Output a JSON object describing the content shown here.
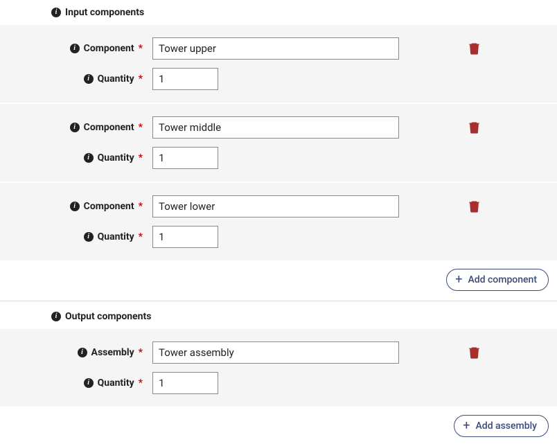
{
  "input_section": {
    "title": "Input components",
    "component_label": "Component",
    "quantity_label": "Quantity",
    "add_button_label": "Add component",
    "rows": [
      {
        "component": "Tower upper",
        "quantity": "1"
      },
      {
        "component": "Tower middle",
        "quantity": "1"
      },
      {
        "component": "Tower lower",
        "quantity": "1"
      }
    ]
  },
  "output_section": {
    "title": "Output components",
    "assembly_label": "Assembly",
    "quantity_label": "Quantity",
    "add_button_label": "Add assembly",
    "rows": [
      {
        "assembly": "Tower assembly",
        "quantity": "1"
      }
    ]
  }
}
